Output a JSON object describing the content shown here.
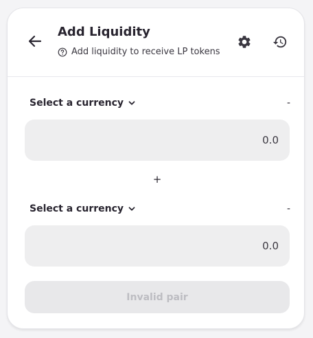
{
  "header": {
    "title": "Add Liquidity",
    "subtitle": "Add liquidity to receive LP tokens",
    "back_icon": "arrow-left-icon",
    "settings_icon": "gear-icon",
    "history_icon": "history-icon",
    "help_icon": "question-circle-icon"
  },
  "currency_a": {
    "select_label": "Select a currency",
    "balance": "-",
    "amount_placeholder": "0.0"
  },
  "plus_sign": "+",
  "currency_b": {
    "select_label": "Select a currency",
    "balance": "-",
    "amount_placeholder": "0.0"
  },
  "submit_button": {
    "label": "Invalid pair",
    "disabled": true
  },
  "colors": {
    "text": "#28242f",
    "input_bg": "#eeeeef",
    "disabled_bg": "#e8e8ea",
    "disabled_text": "#bdbdc2"
  }
}
